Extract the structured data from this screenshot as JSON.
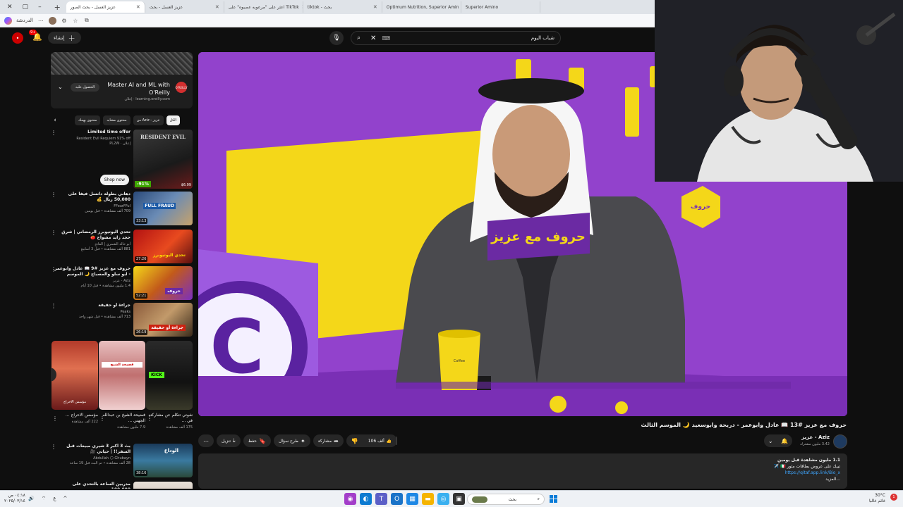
{
  "browser": {
    "tabs": [
      {
        "label": "Superior Amino"
      },
      {
        "label": "Optimum Nutrition, Superior Amin"
      },
      {
        "label": "tiktok - بحث"
      },
      {
        "label": "اعثر على \"مرعوبه عصبوه\" على TikTok"
      },
      {
        "label": "عزيز العسل - بحث"
      },
      {
        "label": "عزيز العسل - بحث الصور"
      }
    ],
    "new_tab": "+",
    "window_controls": [
      "–",
      "▢",
      "✕"
    ],
    "profile_label": "الدردشة"
  },
  "header": {
    "create_label": "إنشاء",
    "notification_count": "9+",
    "search_value": "شباب اليوم",
    "avatar_initial": "•"
  },
  "sidebar": {
    "ad": {
      "title": "Master AI and ML with O'Reilly",
      "meta": "إعلان · learning.oreilly.com",
      "cta": "الحصول عليه",
      "logo": "O'REILLY"
    },
    "chips": [
      {
        "label": "الكل"
      },
      {
        "label": "من Aziz - عزيز"
      },
      {
        "label": "محتوى مشابه"
      },
      {
        "label": "محتوى يهمك"
      }
    ],
    "recommendations": [
      {
        "title": "Limited time offer",
        "channel": "Resident Evil Requiem 91% off",
        "meta": "إعلان · PL2W",
        "discount": "-91%",
        "price": "$6.99",
        "cta": "Shop now",
        "thumb_text": "RESIDENT EVIL",
        "is_ad": true
      },
      {
        "title": "دهاني بطولة دانسل فيفا على 50,000 ريال 💰",
        "channel": "FFearFFul",
        "meta": "709 ألف مشاهدة • قبل يومين",
        "duration": "33:13",
        "thumb_text": "FULL FRAUD"
      },
      {
        "title": "تحدي اليوتيوبرز الرمضاني | شرق حجد زايد مشواح 🍅",
        "channel": "أبو خالد الشمري | الفاتح",
        "meta": "881 ألف مشاهدة • قبل 3 أسابيع",
        "duration": "27:26",
        "thumb_text": "تحدي اليوتيوبرز"
      },
      {
        "title": "حروف مع عزيز #9 📖 عادل وابوعمر - ابو سلو والمصباح 🌙 الموسم الثالث",
        "channel": "Aziz - عزيز",
        "meta": "1.4 مليون مشاهدة • قبل 10 أيام",
        "duration": "52:21",
        "thumb_text": "حروف"
      },
      {
        "title": "جراءة أو حقيقة",
        "channel": "Peaks",
        "meta": "713 ألف مشاهدة • قبل شهر واحد",
        "duration": "26:19",
        "thumb_text": "جراءة أو حقيقة"
      }
    ],
    "shorts": [
      {
        "title": "شوتي تتكلم عن مشاركته في ...",
        "views": "175 ألف مشاهدة",
        "overlay": "KICK"
      },
      {
        "title": "فضيحة الشيخ بن عبدالله الجهني ...",
        "views": "7.9 مليون مشاهدة",
        "overlay": "فضيحة الشيخ"
      },
      {
        "title": "مؤسس الاحراج ...",
        "views": "222 ألف مشاهدة",
        "overlay": "مؤسس الاحراج"
      }
    ],
    "more": [
      {
        "title": "بث 3 أكبر 3 شيري مبيعات قبل السفر!! | حياتي 🎥",
        "channel": "Abdullah 🌕 Ghubayn",
        "meta": "28 ألف مشاهدة • تم البث قبل 19 ساعة",
        "duration": "38:16",
        "thumb_text": "الوداع"
      },
      {
        "title": "مدربين الساعة بالتحدي على 100,000",
        "channel": "",
        "meta": "",
        "duration": "",
        "thumb_text": ""
      }
    ]
  },
  "video": {
    "title": "حروف مع عزيز #13 📖 عادل وابوعمر - دربحة وابوسعيد 🌙 الموسم الثالث",
    "channel": "Aziz - عزيز",
    "subscribers": "3.42 مليون مشترك",
    "likes": "106 ألف",
    "actions": [
      {
        "label": "مشاركة",
        "icon": "share-icon"
      },
      {
        "label": "طرح سؤال",
        "icon": "sparkle-icon"
      },
      {
        "label": "حفظ",
        "icon": "bookmark-icon"
      },
      {
        "label": "تنزيل",
        "icon": "download-icon"
      }
    ],
    "desc_stats": "1.1 مليون مشاهدة  قبل يومين",
    "desc_line1": "تبيك على عروض بطاقات مثور 🇮🇹 ✈️",
    "desc_link": "https://qitaf.app.link/Bio_x",
    "desc_more": "...المزيد",
    "cup_text": "Coffee",
    "card_text": "حروف مع عزيز"
  },
  "taskbar": {
    "time": "٠٤:١٨ ص",
    "date": "٢٠٢٥/٠٣/١٤",
    "search_placeholder": "بحث",
    "weather_temp": "30°C",
    "weather_desc": "غائم غالبا",
    "notifications": "1",
    "lang": "ع"
  },
  "colors": {
    "yt_bg": "#0f0f0f",
    "chip_bg": "#272727",
    "accent_red": "#ff0000",
    "set_purple": "#8a3bc7",
    "set_yellow": "#f4d719",
    "link_blue": "#3ea6ff"
  }
}
